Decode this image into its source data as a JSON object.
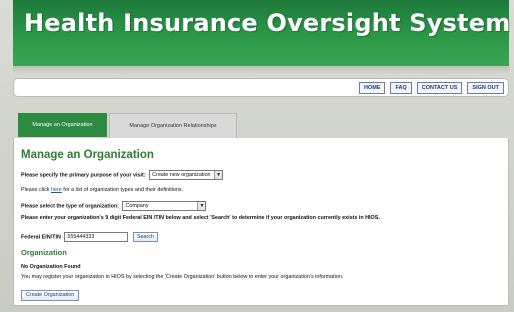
{
  "app": {
    "title": "Health Insurance Oversight System"
  },
  "nav": {
    "buttons": [
      "HOME",
      "FAQ",
      "CONTACT US",
      "SIGN OUT"
    ]
  },
  "tabs": [
    {
      "label": "Manage an Organization",
      "active": true
    },
    {
      "label": "Manage Organization Relationships",
      "active": false
    }
  ],
  "main": {
    "title": "Manage an Organization",
    "purpose_label": "Please specify the primary purpose of your visit:",
    "purpose_value": "Create new organization",
    "click_prefix": "Please click ",
    "click_link": "here",
    "click_suffix": " for a list of organization types and their definitions.",
    "type_label": "Please select the type of organization:",
    "type_value": "Company",
    "ein_instruction": "Please enter your organization's 9 digit Federal EIN /TIN below and select 'Search' to determine if your organization currently exists in HIOS.",
    "ein_label": "Federal EIN/TIN",
    "ein_value": "555444333",
    "search_button": "Search"
  },
  "organization": {
    "heading": "Organization",
    "status": "No Organization Found",
    "message": "You may register your organization in HIOS by selecting the 'Create Organization' button below to enter your organization's information.",
    "create_button": "Create Organization"
  },
  "colors": {
    "brand_green": "#2c8a41",
    "link_blue": "#1a4fb5",
    "nav_text": "#1d3d7a"
  }
}
